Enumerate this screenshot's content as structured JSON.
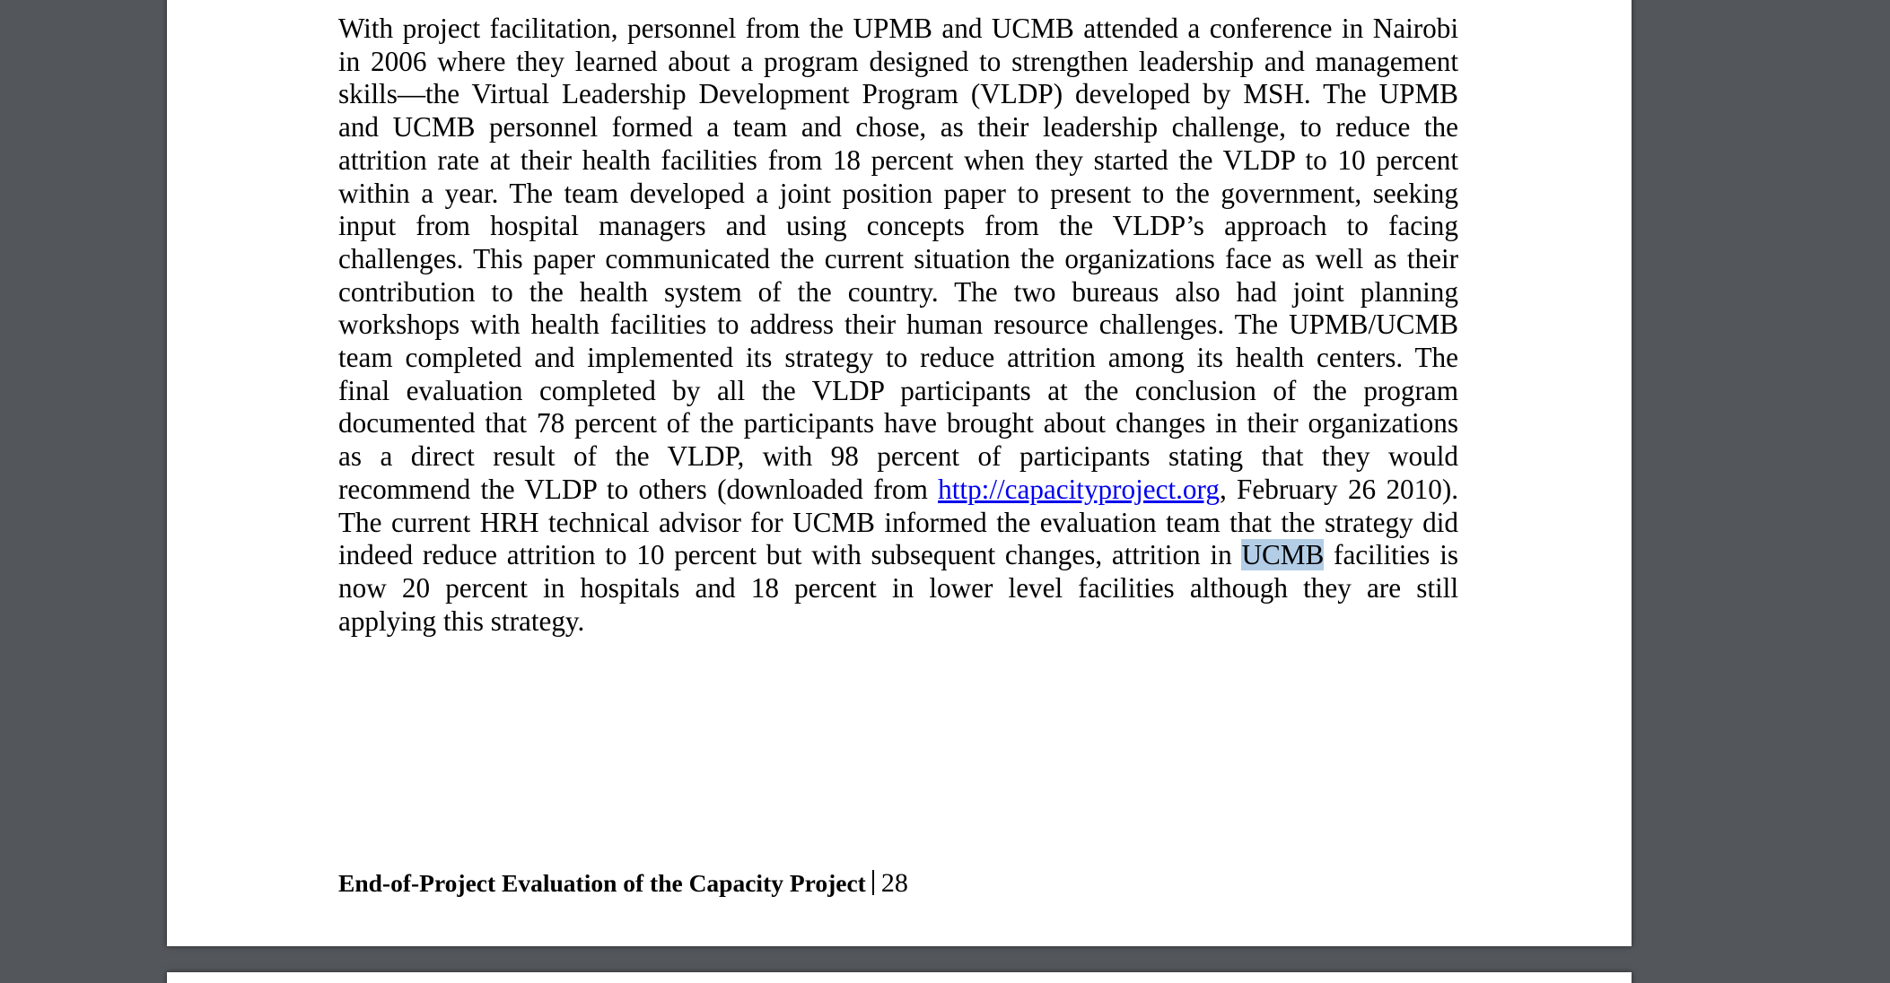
{
  "document": {
    "lines": [
      "With project facilitation, personnel from the UPMB and UCMB attended a conference in Nairobi",
      "in 2006 where they learned about a program designed to strengthen leadership and management",
      "skills—the Virtual Leadership Development Program (VLDP) developed by MSH. The UPMB",
      "and UCMB personnel formed a team and chose, as their leadership challenge, to reduce the",
      "attrition rate at their health facilities from 18 percent when they started the VLDP to 10 percent",
      "within a year. The team developed a joint position paper to present to the government, seeking",
      "input from hospital managers and using concepts from the VLDP’s approach to facing",
      "challenges. This paper communicated the current situation the organizations face as well as their",
      "contribution to the health system of the country. The two bureaus also had joint planning",
      "workshops with health facilities to address their human resource challenges. The UPMB/UCMB",
      "team completed and implemented its strategy to reduce attrition among its health centers. The",
      "final evaluation completed by all the VLDP participants at the conclusion of the program",
      "documented that 78 percent of the participants have brought about changes in their organizations",
      "as a direct result of the VLDP, with 98 percent of participants stating that they would"
    ],
    "line15_before": "recommend the VLDP to others (downloaded from ",
    "link_text": "http://capacityproject.org",
    "line15_after": ", February 26 2010).",
    "line16": "The current HRH technical advisor for UCMB informed the evaluation team that the strategy did",
    "line17_before": "indeed reduce attrition to 10 percent but with subsequent changes, attrition in ",
    "highlight_text": "UCMB",
    "line17_after": " facilities is",
    "line18": "now 20 percent in hospitals and 18 percent in lower level facilities although they are still",
    "line19": "applying this strategy."
  },
  "footer": {
    "title": "End-of-Project Evaluation of the Capacity Project",
    "page_number": "28"
  },
  "colors": {
    "viewer_background": "#53575b",
    "link": "#0000ee",
    "selection_highlight": "#b3cde7"
  }
}
